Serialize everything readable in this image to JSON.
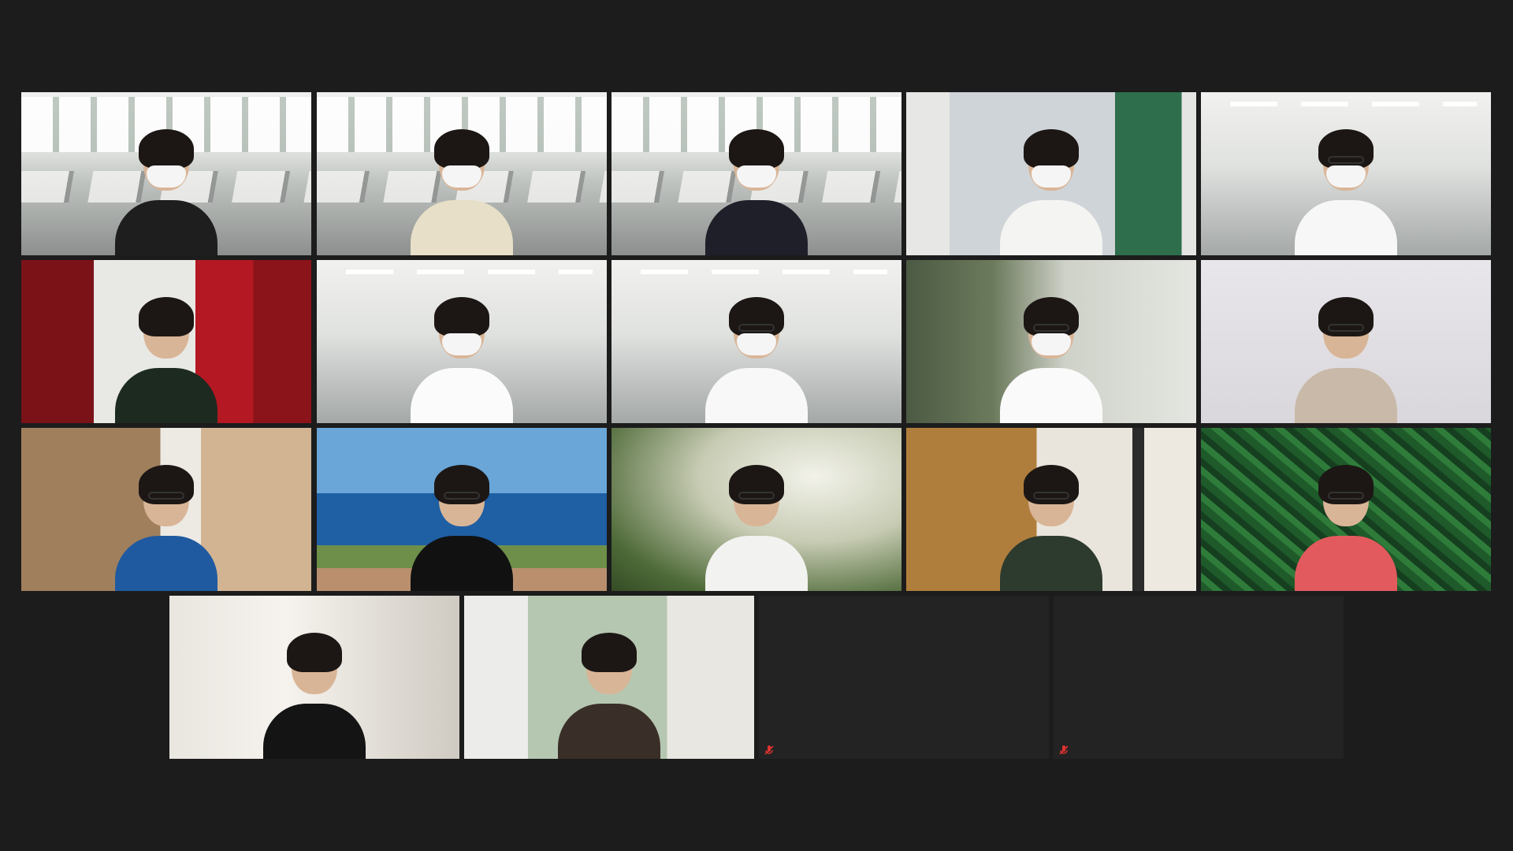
{
  "meeting": {
    "layout": "gallery-view",
    "accent_active_speaker": "#c8e36a",
    "background": "#1c1c1c"
  },
  "participants": [
    {
      "scene": "classroom",
      "masked": true,
      "glasses": false,
      "shirt": "#1e1e1e",
      "active": true
    },
    {
      "scene": "classroom",
      "masked": true,
      "glasses": false,
      "shirt": "#e7dfc7",
      "active": false
    },
    {
      "scene": "classroom",
      "masked": true,
      "glasses": false,
      "shirt": "#1f1f2a",
      "active": false
    },
    {
      "scene": "board",
      "masked": true,
      "glasses": false,
      "shirt": "#f4f4f2",
      "active": false
    },
    {
      "scene": "office",
      "masked": true,
      "glasses": true,
      "shirt": "#f7f7f7",
      "active": false
    },
    {
      "scene": "red-curtain",
      "masked": false,
      "glasses": false,
      "shirt": "#1d2a20",
      "active": false
    },
    {
      "scene": "office",
      "masked": true,
      "glasses": false,
      "shirt": "#fbfbfb",
      "active": false
    },
    {
      "scene": "office",
      "masked": true,
      "glasses": true,
      "shirt": "#f8f8f8",
      "active": false
    },
    {
      "scene": "shelf",
      "masked": true,
      "glasses": true,
      "shirt": "#fafafa",
      "active": false
    },
    {
      "scene": "plain",
      "masked": false,
      "glasses": true,
      "shirt": "#c9b9a8",
      "active": false
    },
    {
      "scene": "wood",
      "masked": false,
      "glasses": true,
      "shirt": "#1f5aa0",
      "active": false
    },
    {
      "scene": "sea",
      "masked": false,
      "glasses": true,
      "shirt": "#111111",
      "active": false
    },
    {
      "scene": "blur-green",
      "masked": false,
      "glasses": true,
      "shirt": "#f2f2f0",
      "active": false
    },
    {
      "scene": "kitchen",
      "masked": false,
      "glasses": true,
      "shirt": "#2d3a2e",
      "active": false
    },
    {
      "scene": "palms",
      "masked": false,
      "glasses": true,
      "shirt": "#e35a5e",
      "active": false
    },
    {
      "scene": "blur-white",
      "masked": false,
      "glasses": false,
      "shirt": "#141414",
      "active": false
    },
    {
      "scene": "window",
      "masked": false,
      "glasses": false,
      "shirt": "#3a2f28",
      "active": false
    }
  ],
  "empty_tiles": [
    {
      "muted": true,
      "mic_icon": "mic-muted-icon"
    },
    {
      "muted": true,
      "mic_icon": "mic-muted-icon"
    }
  ]
}
